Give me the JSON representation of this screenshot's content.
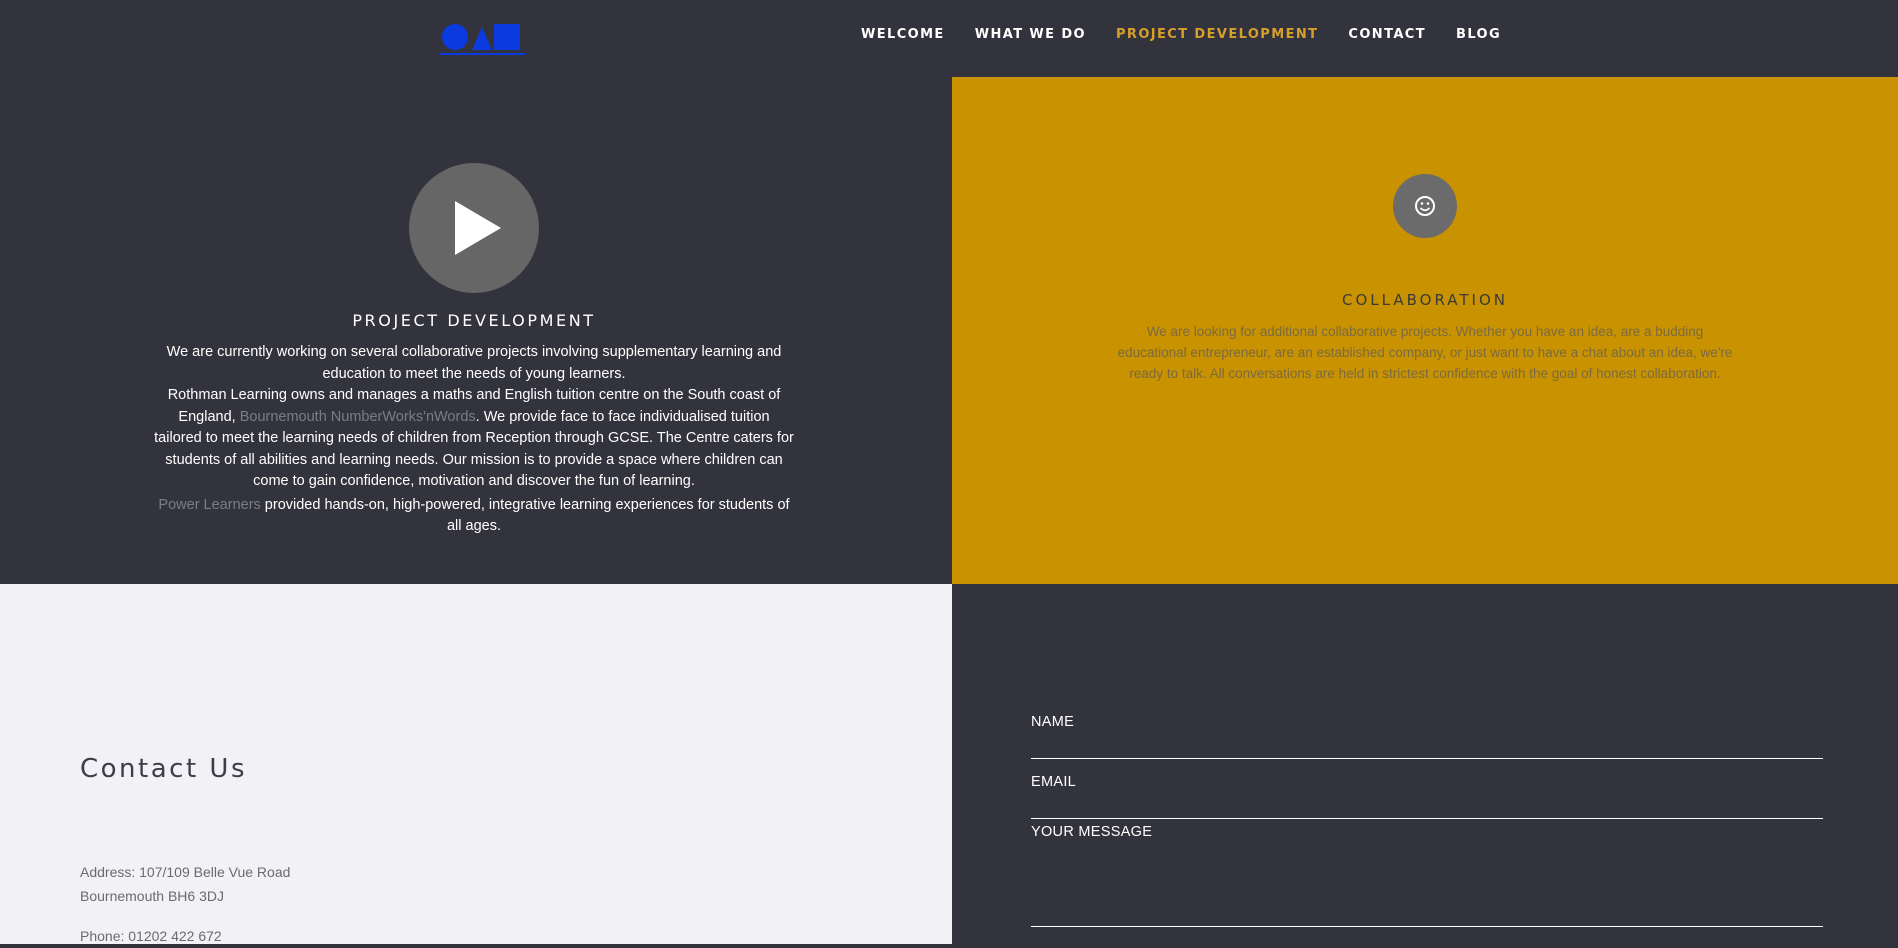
{
  "brand": {
    "logo_colors": [
      "#0b3ae0"
    ]
  },
  "nav": {
    "items": [
      {
        "label": "WELCOME"
      },
      {
        "label": "WHAT WE DO"
      },
      {
        "label": "PROJECT DEVELOPMENT"
      },
      {
        "label": "CONTACT"
      },
      {
        "label": "BLOG"
      }
    ],
    "active_color": "#d6a02a"
  },
  "project": {
    "title": "PROJECT DEVELOPMENT",
    "para1": "We are currently working on several collaborative projects involving supplementary learning and education to meet the needs of young learners.",
    "para2_a": "Rothman Learning owns and manages a maths and English tuition centre on the South coast of England, ",
    "para2_link": "Bournemouth NumberWorks'nWords",
    "para2_b": ". We provide face to face individualised tuition tailored to meet the learning needs of children from Reception through GCSE. The Centre caters for students of all abilities and learning needs. Our mission is to provide a space where children can come to gain confidence, motivation and discover the fun of learning.",
    "para3_link": "Power Learners",
    "para3_b": " provided hands-on, high-powered, integrative learning experiences for students of all ages."
  },
  "collaboration": {
    "title": "COLLABORATION",
    "body": "We are looking for additional collaborative projects.  Whether you have an idea, are a budding educational entrepreneur, are an established company, or just want to have a chat about an idea, we're ready to talk.  All conversations are held in strictest confidence with the goal of honest collaboration.",
    "bg_color": "#c99200"
  },
  "contact": {
    "title": "Contact Us",
    "address_line1": "Address: 107/109 Belle Vue Road",
    "address_line2": "Bournemouth BH6 3DJ",
    "phone": "Phone: 01202 422 672"
  },
  "form": {
    "name_label": "NAME",
    "email_label": "EMAIL",
    "message_label": "YOUR MESSAGE"
  }
}
